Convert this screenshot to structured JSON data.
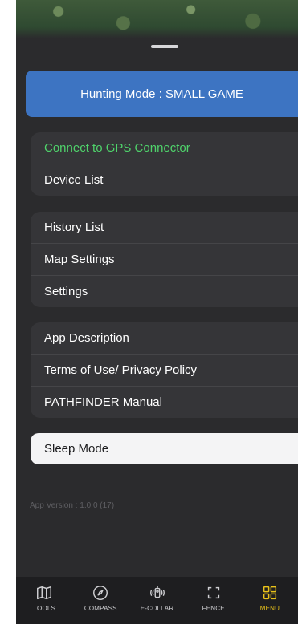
{
  "hunting_mode": {
    "label": "Hunting Mode : SMALL GAME"
  },
  "groups": [
    {
      "items": [
        "Connect to GPS Connector",
        "Device List"
      ]
    },
    {
      "items": [
        "History List",
        "Map Settings",
        "Settings"
      ]
    },
    {
      "items": [
        "App Description",
        "Terms of Use/ Privacy Policy",
        "PATHFINDER Manual"
      ]
    }
  ],
  "sleep_mode": {
    "label": "Sleep Mode"
  },
  "app_version": "App Version : 1.0.0 (17)",
  "tabbar": {
    "tabs": [
      {
        "label": "TOOLS",
        "icon": "map-icon"
      },
      {
        "label": "COMPASS",
        "icon": "compass-icon"
      },
      {
        "label": "E-COLLAR",
        "icon": "collar-icon"
      },
      {
        "label": "FENCE",
        "icon": "fence-icon"
      },
      {
        "label": "MENU",
        "icon": "grid-icon",
        "active": true
      }
    ]
  },
  "colors": {
    "accent_blue": "#3d74c2",
    "connect_green": "#4fd36b",
    "active_tab_yellow": "#e9c21a"
  }
}
